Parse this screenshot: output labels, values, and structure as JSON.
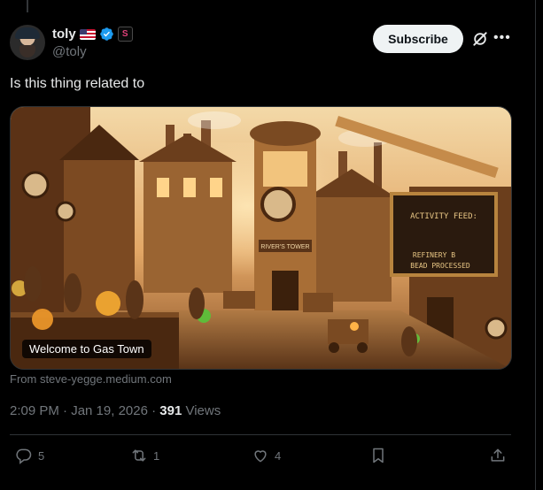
{
  "post": {
    "display_name": "toly",
    "handle": "@toly",
    "subscribe_label": "Subscribe",
    "text": "Is this thing related to",
    "card": {
      "caption": "Welcome to Gas Town",
      "domain": "From steve-yegge.medium.com",
      "scene_text": {
        "sign_title": "ACTIVITY FEED:",
        "sign_line1": "REFINERY B",
        "sign_line2": "BEAD PROCESSED",
        "tower_sign": "RIVER'S TOWER"
      }
    },
    "timestamp": "2:09 PM · Jan 19, 2026 · ",
    "views_count": "391",
    "views_label": " Views",
    "actions": {
      "replies": "5",
      "reposts": "1",
      "likes": "4"
    },
    "icons": [
      "flag-icon",
      "verified-icon",
      "affiliate-icon",
      "grok-icon",
      "more-icon",
      "reply-icon",
      "repost-icon",
      "like-icon",
      "bookmark-icon",
      "share-icon"
    ],
    "colors": {
      "background": "#000000",
      "text": "#e7e9ea",
      "muted": "#71767b",
      "verified": "#1d9bf0",
      "button_bg": "#eff3f4"
    }
  }
}
